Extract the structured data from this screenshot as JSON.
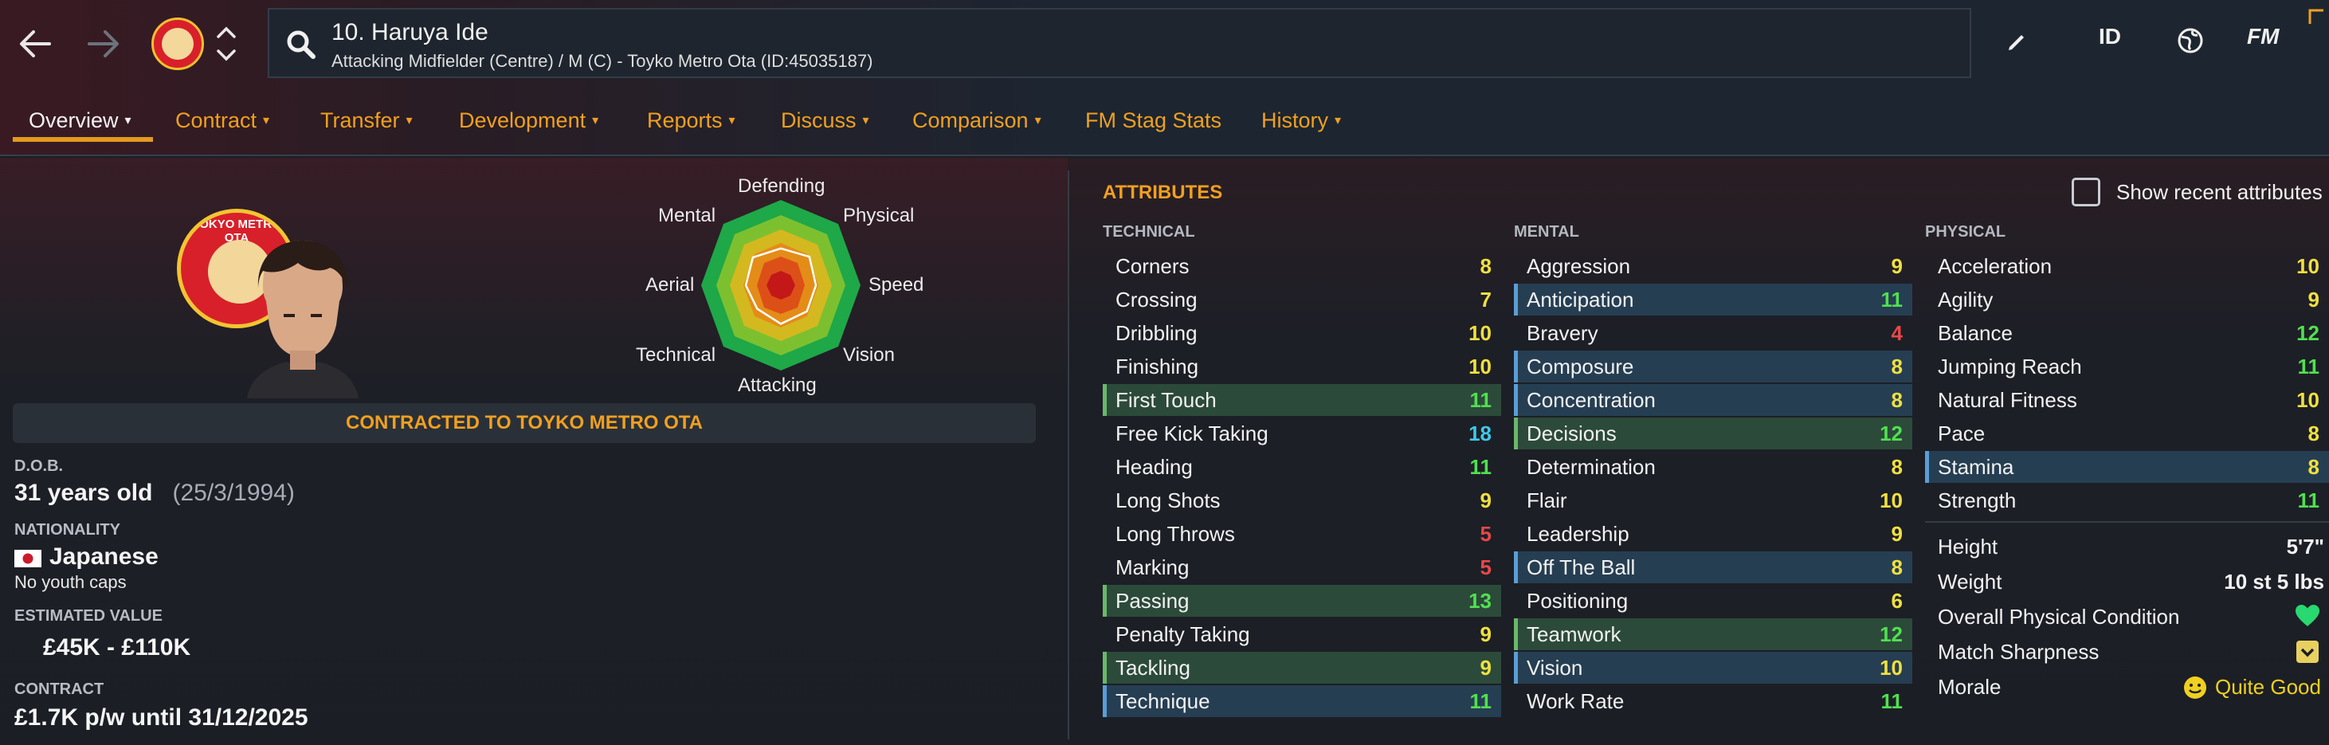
{
  "header": {
    "player_title": "10. Haruya Ide",
    "player_subtitle": "Attacking Midfielder (Centre) / M (C) - Toyko Metro Ota (ID:45035187)",
    "id_label": "ID",
    "fm_label": "FM",
    "club_text": "TOKYO METRO OTA"
  },
  "tabs": [
    {
      "label": "Overview",
      "chevron": true
    },
    {
      "label": "Contract",
      "chevron": true
    },
    {
      "label": "Transfer",
      "chevron": true
    },
    {
      "label": "Development",
      "chevron": true
    },
    {
      "label": "Reports",
      "chevron": true
    },
    {
      "label": "Discuss",
      "chevron": true
    },
    {
      "label": "Comparison",
      "chevron": true
    },
    {
      "label": "FM Stag Stats",
      "chevron": false
    },
    {
      "label": "History",
      "chevron": true
    }
  ],
  "radar": {
    "labels": [
      "Defending",
      "Physical",
      "Speed",
      "Vision",
      "Attacking",
      "Technical",
      "Aerial",
      "Mental"
    ],
    "values": [
      0.42,
      0.46,
      0.4,
      0.42,
      0.44,
      0.38,
      0.4,
      0.45
    ]
  },
  "profile": {
    "contracted_banner": "CONTRACTED TO TOYKO METRO OTA",
    "dob_label": "D.O.B.",
    "age": "31 years old",
    "dob": "(25/3/1994)",
    "nationality_label": "NATIONALITY",
    "nationality": "Japanese",
    "youth_caps": "No youth caps",
    "value_label": "ESTIMATED VALUE",
    "value": "£45K - £110K",
    "contract_label": "CONTRACT",
    "contract": "£1.7K p/w until 31/12/2025"
  },
  "attributes": {
    "heading": "ATTRIBUTES",
    "show_recent_label": "Show recent attributes",
    "technical_label": "TECHNICAL",
    "mental_label": "MENTAL",
    "physical_label": "PHYSICAL",
    "technical": [
      {
        "name": "Corners",
        "value": "8",
        "hl": ""
      },
      {
        "name": "Crossing",
        "value": "7",
        "hl": ""
      },
      {
        "name": "Dribbling",
        "value": "10",
        "hl": ""
      },
      {
        "name": "Finishing",
        "value": "10",
        "hl": ""
      },
      {
        "name": "First Touch",
        "value": "11",
        "hl": "g"
      },
      {
        "name": "Free Kick Taking",
        "value": "18",
        "hl": ""
      },
      {
        "name": "Heading",
        "value": "11",
        "hl": ""
      },
      {
        "name": "Long Shots",
        "value": "9",
        "hl": ""
      },
      {
        "name": "Long Throws",
        "value": "5",
        "hl": ""
      },
      {
        "name": "Marking",
        "value": "5",
        "hl": ""
      },
      {
        "name": "Passing",
        "value": "13",
        "hl": "g"
      },
      {
        "name": "Penalty Taking",
        "value": "9",
        "hl": ""
      },
      {
        "name": "Tackling",
        "value": "9",
        "hl": "g"
      },
      {
        "name": "Technique",
        "value": "11",
        "hl": "b"
      }
    ],
    "mental": [
      {
        "name": "Aggression",
        "value": "9",
        "hl": ""
      },
      {
        "name": "Anticipation",
        "value": "11",
        "hl": "b"
      },
      {
        "name": "Bravery",
        "value": "4",
        "hl": ""
      },
      {
        "name": "Composure",
        "value": "8",
        "hl": "b"
      },
      {
        "name": "Concentration",
        "value": "8",
        "hl": "b"
      },
      {
        "name": "Decisions",
        "value": "12",
        "hl": "g"
      },
      {
        "name": "Determination",
        "value": "8",
        "hl": ""
      },
      {
        "name": "Flair",
        "value": "10",
        "hl": ""
      },
      {
        "name": "Leadership",
        "value": "9",
        "hl": ""
      },
      {
        "name": "Off The Ball",
        "value": "8",
        "hl": "b"
      },
      {
        "name": "Positioning",
        "value": "6",
        "hl": ""
      },
      {
        "name": "Teamwork",
        "value": "12",
        "hl": "g"
      },
      {
        "name": "Vision",
        "value": "10",
        "hl": "b"
      },
      {
        "name": "Work Rate",
        "value": "11",
        "hl": ""
      }
    ],
    "physical": [
      {
        "name": "Acceleration",
        "value": "10",
        "hl": ""
      },
      {
        "name": "Agility",
        "value": "9",
        "hl": ""
      },
      {
        "name": "Balance",
        "value": "12",
        "hl": ""
      },
      {
        "name": "Jumping Reach",
        "value": "11",
        "hl": ""
      },
      {
        "name": "Natural Fitness",
        "value": "10",
        "hl": ""
      },
      {
        "name": "Pace",
        "value": "8",
        "hl": ""
      },
      {
        "name": "Stamina",
        "value": "8",
        "hl": "b"
      },
      {
        "name": "Strength",
        "value": "11",
        "hl": ""
      }
    ]
  },
  "physical_info": {
    "height_label": "Height",
    "height": "5'7\"",
    "weight_label": "Weight",
    "weight": "10 st 5 lbs",
    "condition_label": "Overall Physical Condition",
    "sharpness_label": "Match Sharpness",
    "morale_label": "Morale",
    "morale": "Quite Good"
  },
  "colors": {
    "accent": "#f0a020",
    "value_high": "#50e050",
    "value_mid": "#f0e040",
    "value_low": "#e84848",
    "value_top": "#40c8e8"
  }
}
